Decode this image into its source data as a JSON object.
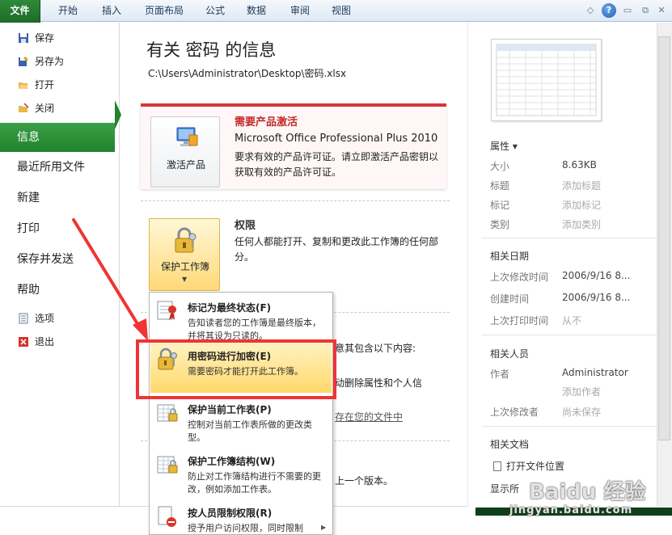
{
  "ribbon": {
    "tabs": [
      "文件",
      "开始",
      "插入",
      "页面布局",
      "公式",
      "数据",
      "审阅",
      "视图"
    ],
    "help": "?"
  },
  "nav": {
    "save": "保存",
    "save_as": "另存为",
    "open": "打开",
    "close": "关闭",
    "info": "信息",
    "recent": "最近所用文件",
    "new": "新建",
    "print": "打印",
    "save_send": "保存并发送",
    "help": "帮助",
    "options": "选项",
    "exit": "退出"
  },
  "main": {
    "title": "有关 密码 的信息",
    "path": "C:\\Users\\Administrator\\Desktop\\密码.xlsx",
    "activation": {
      "button": "激活产品",
      "heading": "需要产品激活",
      "product": "Microsoft Office Professional Plus 2010",
      "desc": "要求有效的产品许可证。请立即激活产品密钥以获取有效的产品许可证。"
    },
    "permissions": {
      "button": "保护工作簿",
      "heading": "权限",
      "desc": "任何人都能打开、复制和更改此工作簿的任何部分。"
    },
    "inspect_tail1": "意其包含以下内容:",
    "inspect_tail2": "动删除属性和个人信",
    "inspect_tail3": "存在您的文件中",
    "versions_tail": "上一个版本。"
  },
  "dropdown": {
    "items": [
      {
        "title": "标记为最终状态(F)",
        "desc": "告知读者您的工作簿是最终版本，并将其设为只读的。"
      },
      {
        "title": "用密码进行加密(E)",
        "desc": "需要密码才能打开此工作簿。"
      },
      {
        "title": "保护当前工作表(P)",
        "desc": "控制对当前工作表所做的更改类型。"
      },
      {
        "title": "保护工作簿结构(W)",
        "desc": "防止对工作簿结构进行不需要的更改，例如添加工作表。"
      },
      {
        "title": "按人员限制权限(R)",
        "desc": "授予用户访问权限，同时限制"
      }
    ]
  },
  "properties": {
    "heading": "属性 ▾",
    "rows": [
      {
        "key": "大小",
        "value": "8.63KB"
      },
      {
        "key": "标题",
        "value": "添加标题"
      },
      {
        "key": "标记",
        "value": "添加标记"
      },
      {
        "key": "类别",
        "value": "添加类别"
      }
    ],
    "dates_heading": "相关日期",
    "dates": [
      {
        "key": "上次修改时间",
        "value": "2006/9/16 8..."
      },
      {
        "key": "创建时间",
        "value": "2006/9/16 8..."
      },
      {
        "key": "上次打印时间",
        "value": "从不"
      }
    ],
    "people_heading": "相关人员",
    "author_key": "作者",
    "author_value": "Administrator",
    "add_author": "添加作者",
    "last_modified_by_key": "上次修改者",
    "last_modified_by_value": "尚未保存",
    "docs_heading": "相关文档",
    "open_location": "打开文件位置",
    "show_all": "显示所"
  },
  "watermark": {
    "main": "Baidu 经验",
    "sub": "jingyan.baidu.com"
  },
  "colors": {
    "file_tab": "#1c6b27",
    "info_selected": "#21832d",
    "activation_red": "#d9343a",
    "highlight_red": "#f03434",
    "hover_yellow": "#ffd86a"
  }
}
